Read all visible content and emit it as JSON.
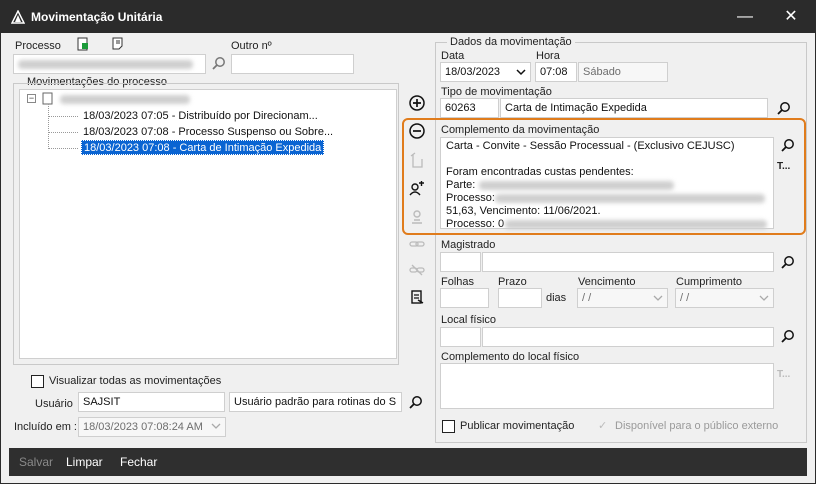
{
  "window": {
    "title": "Movimentação Unitária",
    "minimize": "—",
    "maximize": "☐",
    "close": "✕"
  },
  "left": {
    "processo_label": "Processo",
    "outro_label": "Outro nº",
    "group_label": "Movimentações do processo",
    "tree": [
      "18/03/2023 07:05 - Distribuído por Direcionam...",
      "18/03/2023 07:08 - Processo Suspenso ou Sobre...",
      "18/03/2023 07:08 - Carta de Intimação Expedida"
    ],
    "visualizar_label": "Visualizar todas as movimentações",
    "usuario_label": "Usuário",
    "usuario_value": "SAJSIT",
    "usuario_desc": "Usuário padrão para rotinas do S",
    "incluido_label": "Incluído em :",
    "incluido_value": "18/03/2023 07:08:24 AM"
  },
  "right": {
    "group_label": "Dados da movimentação",
    "data_label": "Data",
    "data_value": "18/03/2023",
    "hora_label": "Hora",
    "hora_value": "07:08",
    "dia_value": "Sábado",
    "tipo_label": "Tipo de movimentação",
    "tipo_code": "60263",
    "tipo_desc": "Carta de Intimação Expedida",
    "complemento_label": "Complemento da movimentação",
    "complemento_lines": [
      "Carta - Convite - Sessão Processual - (Exclusivo CEJUSC)",
      "",
      "Foram encontradas custas pendentes:",
      "Parte:",
      "Processo:",
      "51,63, Vencimento: 11/06/2021.",
      "Processo: 0"
    ],
    "text_btn": "T...",
    "magistrado_label": "Magistrado",
    "folhas_label": "Folhas",
    "prazo_label": "Prazo",
    "dias_label": "dias",
    "vencimento_label": "Vencimento",
    "vencimento_value": "/ /",
    "cumprimento_label": "Cumprimento",
    "cumprimento_value": "/ /",
    "local_label": "Local físico",
    "comp_local_label": "Complemento do local físico",
    "comp_local_btn": "T...",
    "publicar_label": "Publicar movimentação",
    "disponivel_label": "Disponível para o público externo"
  },
  "footer": {
    "salvar": "Salvar",
    "limpar": "Limpar",
    "fechar": "Fechar"
  },
  "colors": {
    "titlebar": "#2b2b2b",
    "selection": "#0a64d2",
    "highlight": "#e07c1c"
  }
}
